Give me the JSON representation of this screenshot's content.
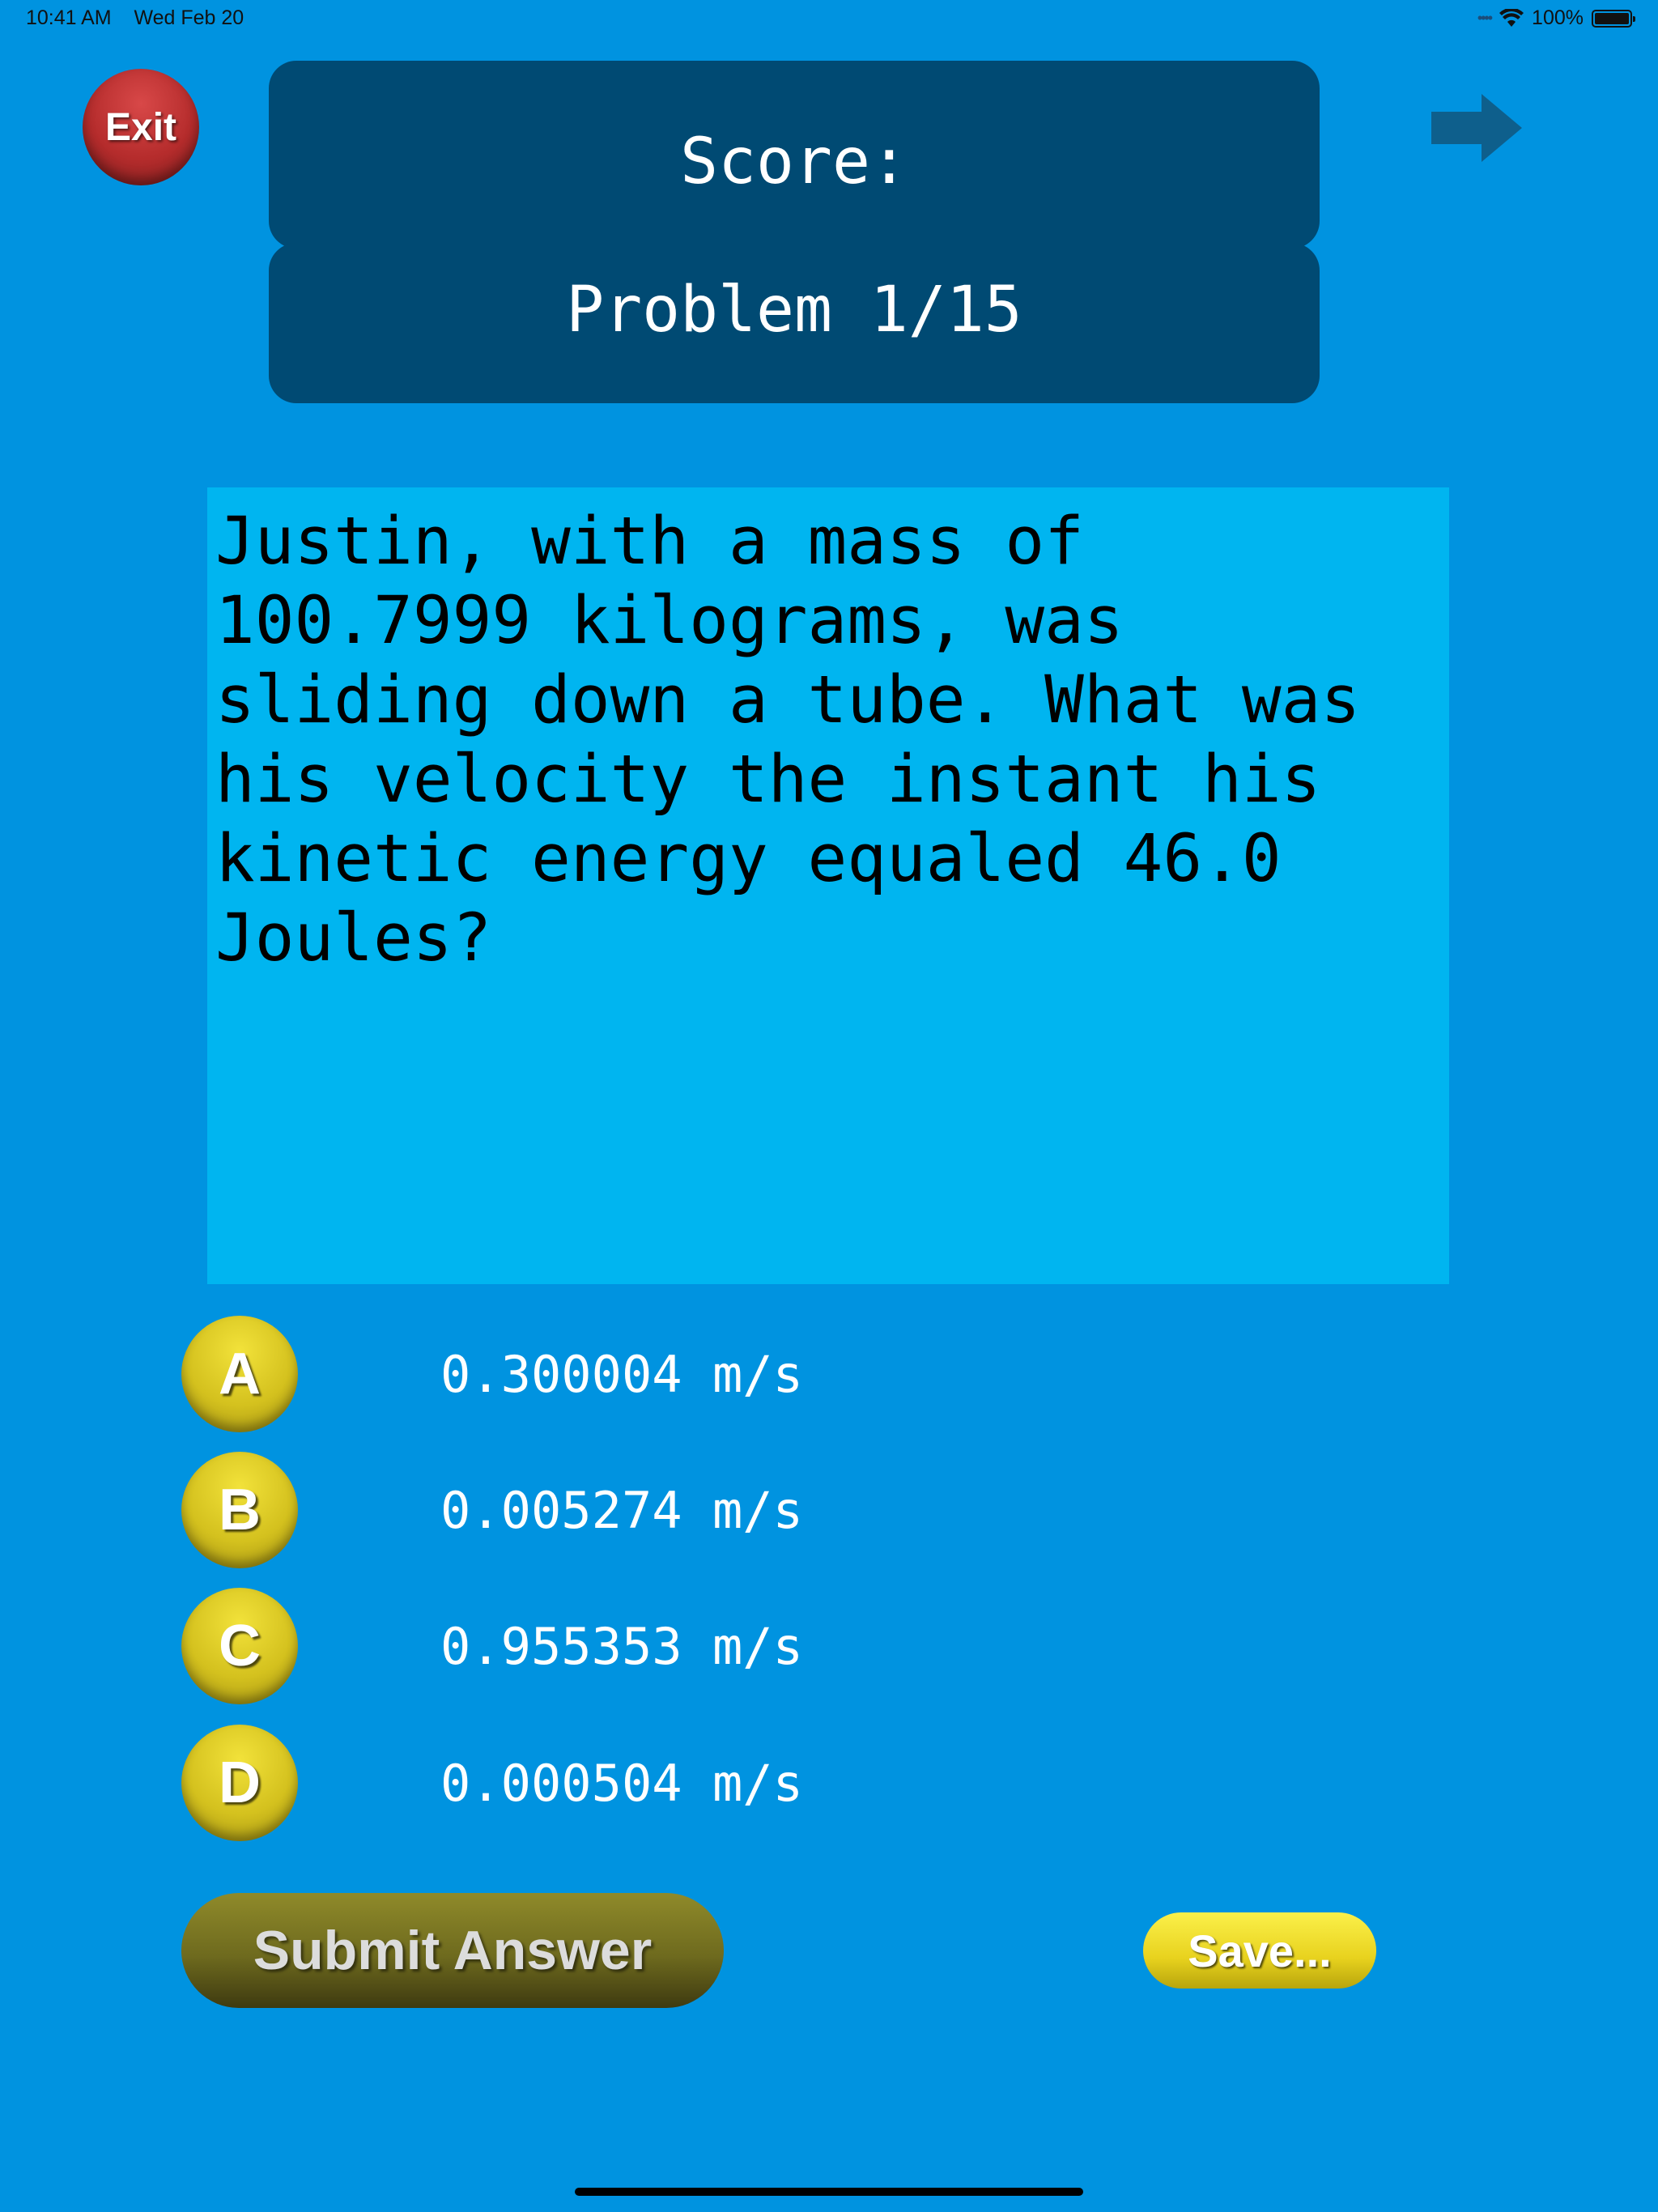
{
  "status_bar": {
    "time": "10:41 AM",
    "date": "Wed Feb 20",
    "battery": "100%"
  },
  "header": {
    "exit_label": "Exit",
    "score_label": "Score:",
    "problem_label": "Problem 1/15"
  },
  "question": {
    "text": "Justin, with a mass of\n100.7999 kilograms, was\nsliding down a tube. What was\nhis velocity the instant his\nkinetic energy equaled 46.0\nJoules?"
  },
  "options": [
    {
      "letter": "A",
      "value": "0.300004 m/s"
    },
    {
      "letter": "B",
      "value": "0.005274 m/s"
    },
    {
      "letter": "C",
      "value": "0.955353 m/s"
    },
    {
      "letter": "D",
      "value": "0.000504 m/s"
    }
  ],
  "actions": {
    "submit_label": "Submit Answer",
    "save_label": "Save..."
  },
  "colors": {
    "background": "#0093e0",
    "panel": "#004a73",
    "question_box": "#00b5f0",
    "exit": "#b52c2c",
    "badge": "#d4c11e"
  }
}
